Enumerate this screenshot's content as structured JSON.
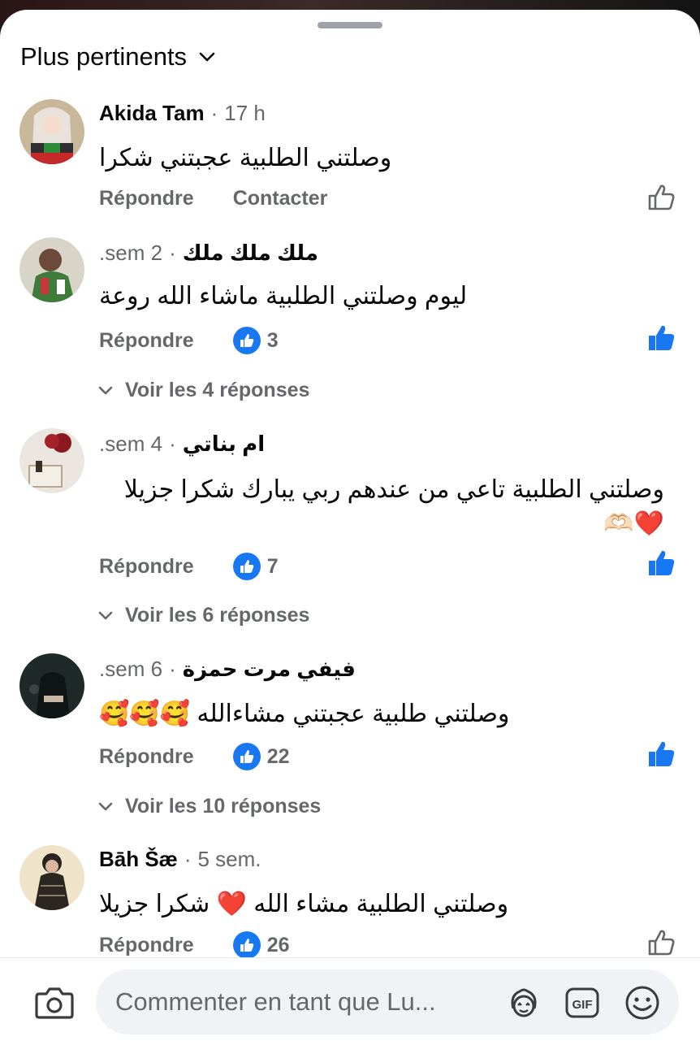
{
  "sort": {
    "label": "Plus pertinents"
  },
  "comments": [
    {
      "author": "Akida Tam",
      "time": "17 h",
      "text": "وصلتني الطلبية عجبتني شكرا",
      "reply_label": "Répondre",
      "contact_label": "Contacter",
      "liked": false
    },
    {
      "author": "ملك ملك ملك",
      "time": "2 sem.",
      "text": "ليوم وصلتني الطلبية ماشاء الله روعة",
      "reply_label": "Répondre",
      "reactions": "3",
      "liked": true,
      "replies_label": "Voir les 4 réponses"
    },
    {
      "author": "ام بناتي",
      "time": "4 sem.",
      "text": "وصلتني الطلبية تاعي من عندهم ربي يبارك شكرا جزيلا ❤️🫶🏻",
      "reply_label": "Répondre",
      "reactions": "7",
      "liked": true,
      "replies_label": "Voir les 6 réponses"
    },
    {
      "author": "فيفي مرت حمزة",
      "time": "6 sem.",
      "text": "وصلتني طلبية عجبتني مشاءالله 🥰🥰🥰",
      "reply_label": "Répondre",
      "reactions": "22",
      "liked": true,
      "replies_label": "Voir les 10 réponses"
    },
    {
      "author": "Bāh Šæ",
      "time": "5 sem.",
      "text": "وصلتني الطلبية مشاء الله ❤️ شكرا جزيلا",
      "reply_label": "Répondre",
      "reactions": "26",
      "liked": false
    }
  ],
  "composer": {
    "placeholder": "Commenter en tant que Lu...",
    "icons": [
      "camera-icon",
      "avatar-sticker-icon",
      "gif-icon",
      "emoji-icon"
    ]
  },
  "colors": {
    "accent": "#1877f2",
    "muted": "#65676b",
    "text": "#080809"
  }
}
